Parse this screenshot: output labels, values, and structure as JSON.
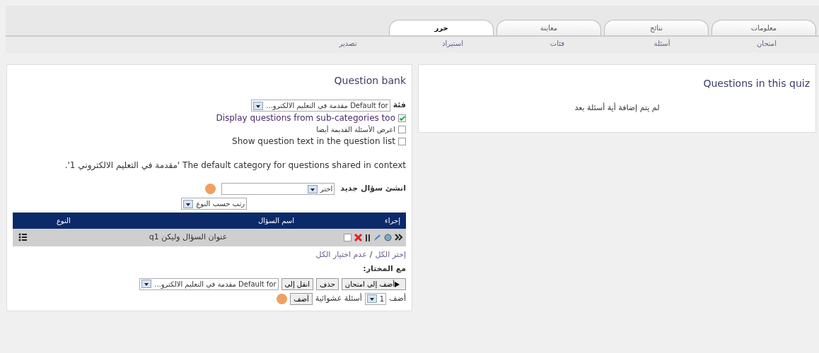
{
  "tabs": [
    {
      "label": "معلومات",
      "selected": false
    },
    {
      "label": "نتائج",
      "selected": false
    },
    {
      "label": "معاينة",
      "selected": false
    },
    {
      "label": "حرر",
      "selected": true
    }
  ],
  "subtabs": [
    {
      "label": "امتحان",
      "selected": false
    },
    {
      "label": "أسئلة",
      "selected": false
    },
    {
      "label": "فئات",
      "selected": false
    },
    {
      "label": "استيراد",
      "selected": false
    },
    {
      "label": "تصدير",
      "selected": false
    }
  ],
  "quiz_panel": {
    "title": "Questions in this quiz",
    "empty_message": "لم يتم إضافة أية أسئلة بعد"
  },
  "bank_panel": {
    "title": "Question bank",
    "category": {
      "label": "فئة",
      "value": "Default for مقدمة في التعليم الالكترو..."
    },
    "options": [
      {
        "label": "Display questions from sub-categories too",
        "checked": true
      },
      {
        "label": "اعرض الأسئلة القديمة أيضا",
        "checked": false
      },
      {
        "label": "Show question text in the question list",
        "checked": false
      }
    ],
    "category_info": "The default category for questions shared in context 'مقدمة في التعليم الالكتروني 1'.",
    "create_new": {
      "label": "انشئ سؤال جديد",
      "value": "اختر"
    },
    "sort": {
      "value": "رتب حسب النوع"
    },
    "table": {
      "columns": [
        "إجراء",
        "اسم السؤال",
        "النوع"
      ],
      "rows": [
        {
          "selected": false,
          "name": "عنوان السؤال وليكن q1"
        }
      ]
    },
    "select_links": [
      "إختر الكل",
      "عدم اختيار الكل"
    ],
    "select_separator": "/",
    "with_selected": "مع المختار:",
    "buttons": [
      {
        "label": "أضف إلى امتحان",
        "kind": "play"
      },
      {
        "label": "حذف",
        "kind": "plain"
      },
      {
        "label": "انقل إلى",
        "kind": "plain"
      }
    ],
    "move_target": "Default for مقدمة في التعليم الالكترو...",
    "random": {
      "label": "أضف",
      "count": "1",
      "text": "أسئلة عشوائية",
      "button": "أضف"
    }
  }
}
